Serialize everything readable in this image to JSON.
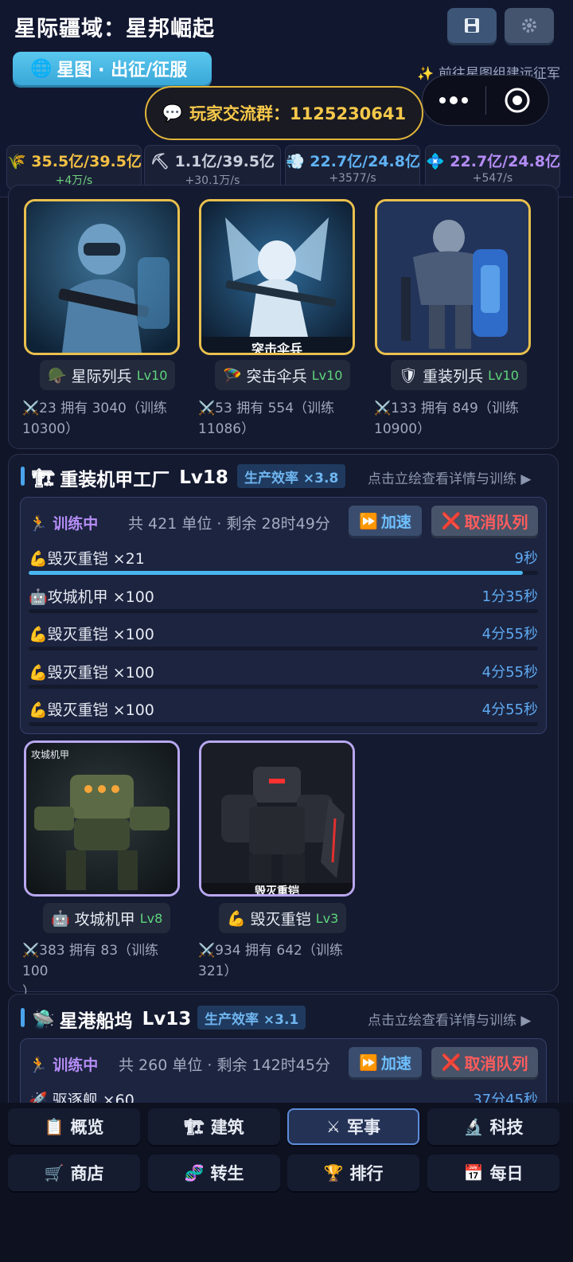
{
  "header": {
    "title": "星际疆域：星邦崛起",
    "map_pill": "星图 · 出征/征服",
    "expedition_link": "✨ 前往星图组建远征军",
    "qq_group": "玩家交流群：1125230641"
  },
  "resources": [
    {
      "icon": "wheat",
      "value": "35.5亿/39.5亿",
      "rate": "+4万/s",
      "color": "#f3c043",
      "rate_color": "#6fd07f"
    },
    {
      "icon": "pickaxe",
      "value": "1.1亿/39.5亿",
      "rate": "+30.1万/s",
      "color": "#c9cfdb",
      "rate_color": "#8e97ad"
    },
    {
      "icon": "gas",
      "value": "22.7亿/24.8亿",
      "rate": "+3577/s",
      "color": "#5fb2f4",
      "rate_color": "#8e97ad"
    },
    {
      "icon": "crystal",
      "value": "22.7亿/24.8亿",
      "rate": "+547/s",
      "color": "#b48cf5",
      "rate_color": "#8e97ad"
    }
  ],
  "infantry_units": [
    {
      "icon": "helmet-icon",
      "name": "星际列兵",
      "level": "Lv10",
      "stat1": "⚔️23 拥有 3040（训练",
      "stat2": "10300）",
      "portrait_label": ""
    },
    {
      "icon": "parachute-icon",
      "name": "突击伞兵",
      "level": "Lv10",
      "stat1": "⚔️53 拥有 554（训练",
      "stat2": "11086）",
      "portrait_label": "突击伞兵"
    },
    {
      "icon": "shield-icon",
      "name": "重装列兵",
      "level": "Lv10",
      "stat1": "⚔️133 拥有 849（训练",
      "stat2": "10900）",
      "portrait_label": ""
    }
  ],
  "mech_factory": {
    "title": "重装机甲工厂",
    "level": "Lv18",
    "efficiency": "生产效率 ×3.8",
    "hint": "点击立绘查看详情与训练 ▶",
    "queue": {
      "status": "训练中",
      "summary": "共 421 单位 · 剩余 28时49分",
      "speed": "加速",
      "cancel": "取消队列",
      "rows": [
        {
          "icon": "💪",
          "name": "毁灭重铠 ×21",
          "time": "9秒",
          "progress": 0.97
        },
        {
          "icon": "🤖",
          "name": "攻城机甲 ×100",
          "time": "1分35秒",
          "progress": 0
        },
        {
          "icon": "💪",
          "name": "毁灭重铠 ×100",
          "time": "4分55秒",
          "progress": 0
        },
        {
          "icon": "💪",
          "name": "毁灭重铠 ×100",
          "time": "4分55秒",
          "progress": 0
        },
        {
          "icon": "💪",
          "name": "毁灭重铠 ×100",
          "time": "4分55秒",
          "progress": 0
        }
      ]
    },
    "units": [
      {
        "icon": "🤖",
        "name": "攻城机甲",
        "level": "Lv8",
        "stat1": "⚔️383 拥有 83（训练 100",
        "stat2": "）",
        "portrait_label": "攻城机甲"
      },
      {
        "icon": "💪",
        "name": "毁灭重铠",
        "level": "Lv3",
        "stat1": "⚔️934 拥有 642（训练",
        "stat2": "321）",
        "portrait_label": "毁灭重铠"
      }
    ]
  },
  "shipyard": {
    "title": "星港船坞",
    "level": "Lv13",
    "efficiency": "生产效率 ×3.1",
    "hint": "点击立绘查看详情与训练 ▶",
    "queue": {
      "status": "训练中",
      "summary": "共 260 单位 · 剩余 142时45分",
      "speed": "加速",
      "cancel": "取消队列",
      "rows": [
        {
          "icon": "🚀",
          "name": "驱逐舰 ×60",
          "time": "37分45秒"
        }
      ]
    }
  },
  "nav": [
    {
      "icon": "📋",
      "label": "概览"
    },
    {
      "icon": "🏗",
      "label": "建筑"
    },
    {
      "icon": "⚔",
      "label": "军事",
      "active": true
    },
    {
      "icon": "🔬",
      "label": "科技"
    },
    {
      "icon": "🛒",
      "label": "商店"
    },
    {
      "icon": "🧬",
      "label": "转生"
    },
    {
      "icon": "🏆",
      "label": "排行"
    },
    {
      "icon": "📅",
      "label": "每日"
    }
  ]
}
